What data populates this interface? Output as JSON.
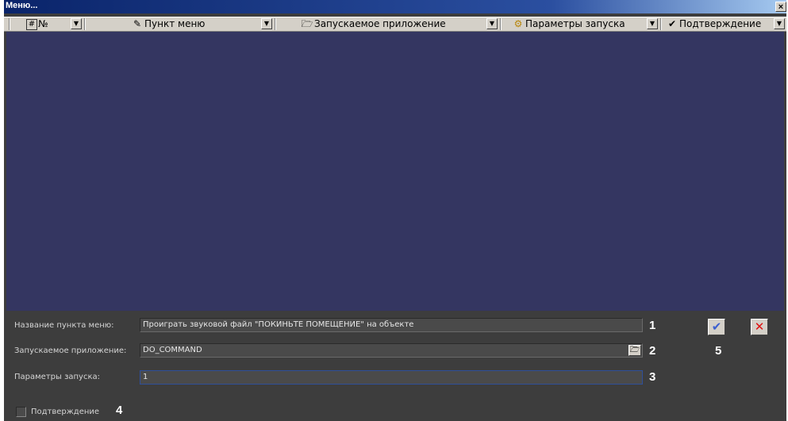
{
  "window": {
    "title": "Меню...",
    "close_glyph": "×"
  },
  "columns": [
    {
      "icon": "#",
      "label": "№"
    },
    {
      "icon": "✎",
      "label": "Пункт меню"
    },
    {
      "icon": "🗁",
      "label": "Запускаемое приложение"
    },
    {
      "icon": "⚙",
      "label": "Параметры запуска"
    },
    {
      "icon": "✔",
      "label": "Подтверждение"
    }
  ],
  "dropdown_glyph": "▼",
  "form": {
    "name_label": "Название пункта меню:",
    "name_value": "Проиграть звуковой файл \"ПОКИНЬТЕ ПОМЕЩЕНИЕ\" на объекте",
    "app_label": "Запускаемое приложение:",
    "app_value": "DO_COMMAND",
    "params_label": "Параметры запуска:",
    "params_value": "1",
    "confirm_label": "Подтверждение",
    "browse_glyph": "🗁",
    "ok_glyph": "✔",
    "cancel_glyph": "✕"
  },
  "callouts": [
    "1",
    "2",
    "3",
    "4",
    "5"
  ],
  "colors": {
    "grid_background": "#343661",
    "form_background": "#3d3d3d",
    "title_bar": "#0a246a"
  }
}
